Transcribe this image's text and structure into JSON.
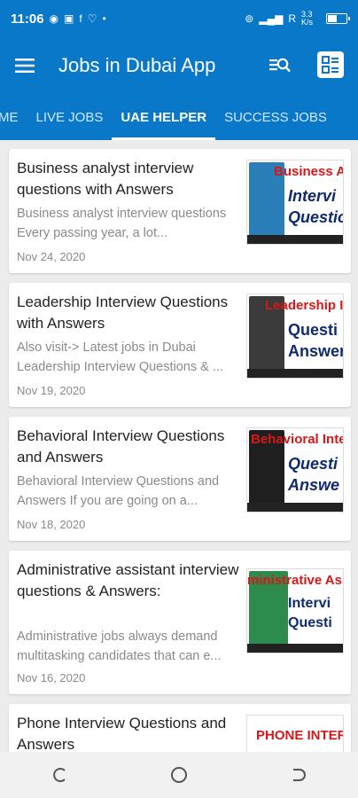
{
  "status": {
    "time": "11:06",
    "signal": "R",
    "speed": "3.3 K/s",
    "battery_level": 0.55
  },
  "app": {
    "title": "Jobs in Dubai App"
  },
  "tabs": [
    "ME",
    "LIVE JOBS",
    "UAE HELPER",
    "SUCCESS JOBS"
  ],
  "active_tab": "UAE HELPER",
  "posts": [
    {
      "title": "Business analyst interview questions with Answers",
      "excerpt": "Business analyst interview questions Every passing year, a lot...",
      "date": "Nov 24, 2020",
      "thumb_red": "Business An",
      "thumb_blue1": "Intervi",
      "thumb_blue2": "Questio"
    },
    {
      "title": "Leadership Interview Questions with Answers",
      "excerpt": "Also visit-> Latest jobs in Dubai Leadership Interview Questions & ...",
      "date": "Nov 19, 2020",
      "thumb_red": "Leadership Int",
      "thumb_blue1": "Questi",
      "thumb_blue2": "Answer"
    },
    {
      "title": "Behavioral Interview Questions and Answers",
      "excerpt": "Behavioral Interview Questions and Answers If you are going on a...",
      "date": "Nov 18, 2020",
      "thumb_red": "Behavioral Inte",
      "thumb_blue1": "Questi",
      "thumb_blue2": "Answe"
    },
    {
      "title": "Administrative assistant interview questions & Answers:",
      "excerpt": "Administrative jobs always demand multitasking candidates that can e...",
      "date": "Nov 16, 2020",
      "thumb_red": "ministrative Ass",
      "thumb_blue1": "Intervi",
      "thumb_blue2": "Questi"
    },
    {
      "title": "Phone Interview Questions and Answers",
      "excerpt": "",
      "date": "",
      "thumb_red": "PHONE INTER",
      "thumb_blue1": "",
      "thumb_blue2": ""
    }
  ],
  "colors": {
    "primary": "#0a78c8",
    "thumb_red": "#d61818",
    "thumb_blue": "#0f2a6e"
  },
  "icons": [
    "menu-icon",
    "search-list-icon",
    "grid-icon",
    "recent-apps-icon",
    "home-icon",
    "back-icon"
  ]
}
